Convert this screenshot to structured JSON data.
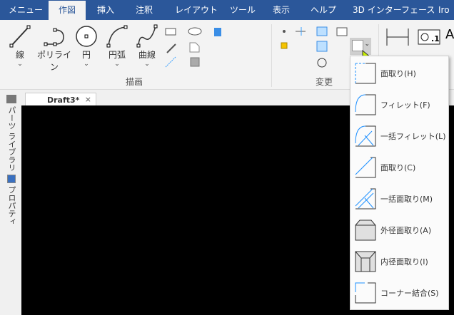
{
  "tabs": [
    "メニュー",
    "作図",
    "挿入",
    "注釈",
    "レイアウト",
    "ツール",
    "表示",
    "ヘルプ",
    "3D インターフェース",
    "Iro"
  ],
  "active_tab": "作図",
  "draw_group": {
    "label": "描画",
    "buttons": [
      "線",
      "ポリライン",
      "円",
      "円弧",
      "曲線"
    ]
  },
  "modify_group": {
    "label": "変更"
  },
  "annot_buttons": [
    "寸法",
    "注釈"
  ],
  "document_tab": {
    "title": "Draft3*",
    "close": "×"
  },
  "sidebar": [
    "パーツ ライブラリ",
    "プロパティ"
  ],
  "dropdown_menu": [
    "面取り(H)",
    "フィレット(F)",
    "一括フィレット(L)",
    "面取り(C)",
    "一括面取り(M)",
    "外径面取り(A)",
    "内径面取り(I)",
    "コーナー結合(S)"
  ],
  "colors": {
    "tabbar": "#2b579a",
    "accent": "#1e90ff",
    "canvas": "#000000"
  }
}
